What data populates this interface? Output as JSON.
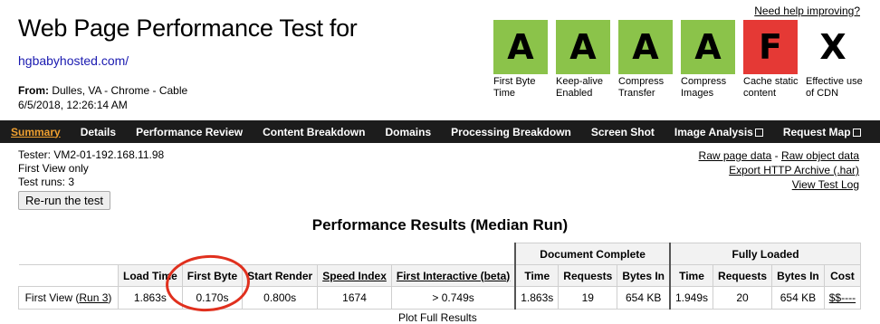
{
  "header": {
    "help_link": "Need help improving?",
    "title": "Web Page Performance Test for",
    "url": "hgbabyhosted.com/",
    "from_label": "From:",
    "from_value": "Dulles, VA - Chrome - Cable",
    "date": "6/5/2018, 12:26:14 AM"
  },
  "grades": [
    {
      "letter": "A",
      "label": "First Byte Time",
      "color": "#8bc34a"
    },
    {
      "letter": "A",
      "label": "Keep-alive Enabled",
      "color": "#8bc34a"
    },
    {
      "letter": "A",
      "label": "Compress Transfer",
      "color": "#8bc34a"
    },
    {
      "letter": "A",
      "label": "Compress Images",
      "color": "#8bc34a"
    },
    {
      "letter": "F",
      "label": "Cache static content",
      "color": "#e53935"
    },
    {
      "letter": "X",
      "label": "Effective use of CDN",
      "color": "#ffffff"
    }
  ],
  "nav": {
    "tabs": [
      "Summary",
      "Details",
      "Performance Review",
      "Content Breakdown",
      "Domains",
      "Processing Breakdown",
      "Screen Shot",
      "Image Analysis",
      "Request Map"
    ],
    "active_color": "#f0a030",
    "bg_color": "#1c1c1c"
  },
  "info": {
    "tester": "Tester: VM2-01-192.168.11.98",
    "view": "First View only",
    "runs_label": "Test runs:",
    "runs_value": "3",
    "rerun_button": "Re-run the test"
  },
  "links": {
    "raw_page": "Raw page data",
    "sep": " - ",
    "raw_object": "Raw object data",
    "export_har": "Export HTTP Archive (.har)",
    "test_log": "View Test Log"
  },
  "results": {
    "title": "Performance Results (Median Run)",
    "group_doc": "Document Complete",
    "group_full": "Fully Loaded",
    "columns": [
      "Load Time",
      "First Byte",
      "Start Render",
      "Speed Index",
      "First Interactive (beta)",
      "Time",
      "Requests",
      "Bytes In",
      "Time",
      "Requests",
      "Bytes In",
      "Cost"
    ],
    "row": {
      "label": "First View (",
      "run_link": "Run 3",
      "label_end": ")",
      "values": [
        "1.863s",
        "0.170s",
        "0.800s",
        "1674",
        "> 0.749s",
        "1.863s",
        "19",
        "654 KB",
        "1.949s",
        "20",
        "654 KB"
      ],
      "cost": "$$----"
    },
    "plot_full": "Plot Full Results"
  },
  "annotation_color": "#e0301e"
}
